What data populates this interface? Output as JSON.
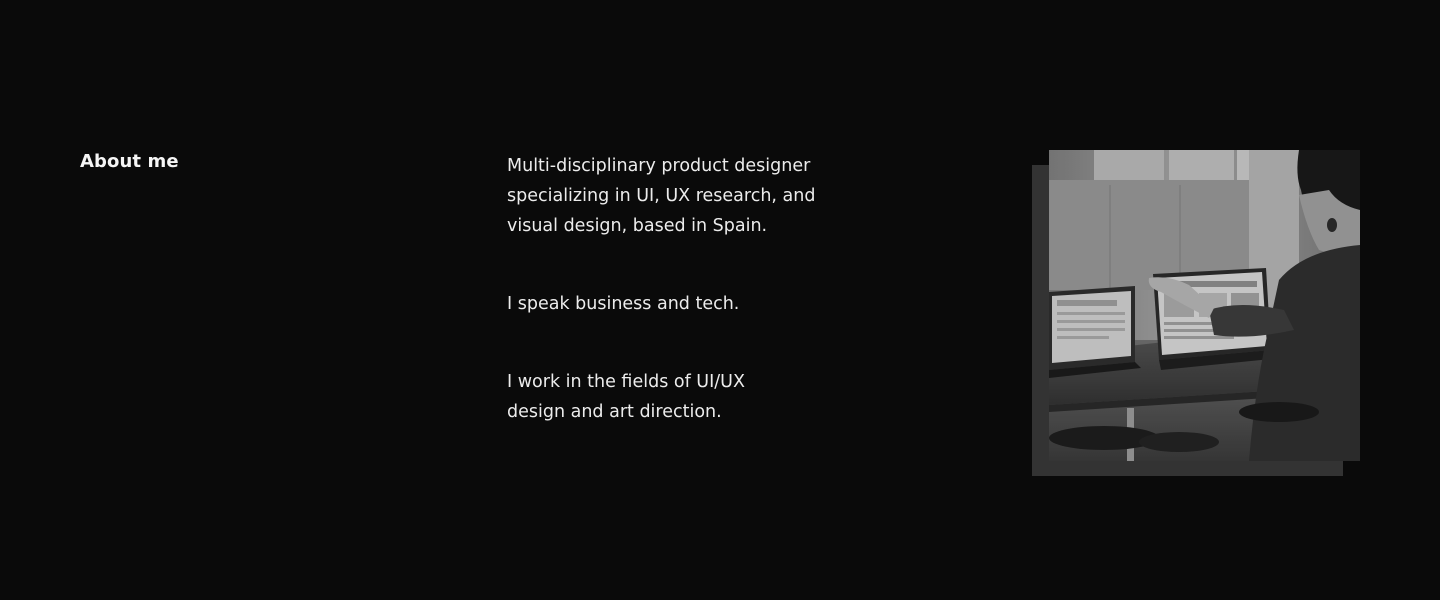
{
  "about": {
    "title": "About me",
    "paragraphs": [
      "Multi-disciplinary product designer\nspecializing in UI, UX research, and\nvisual design, based in Spain.",
      "I speak business and tech.",
      "I work in the fields of UI/UX\ndesign and  art direction."
    ],
    "photo_alt": "Grayscale photo of a person presenting on a laptop at a meeting table"
  }
}
